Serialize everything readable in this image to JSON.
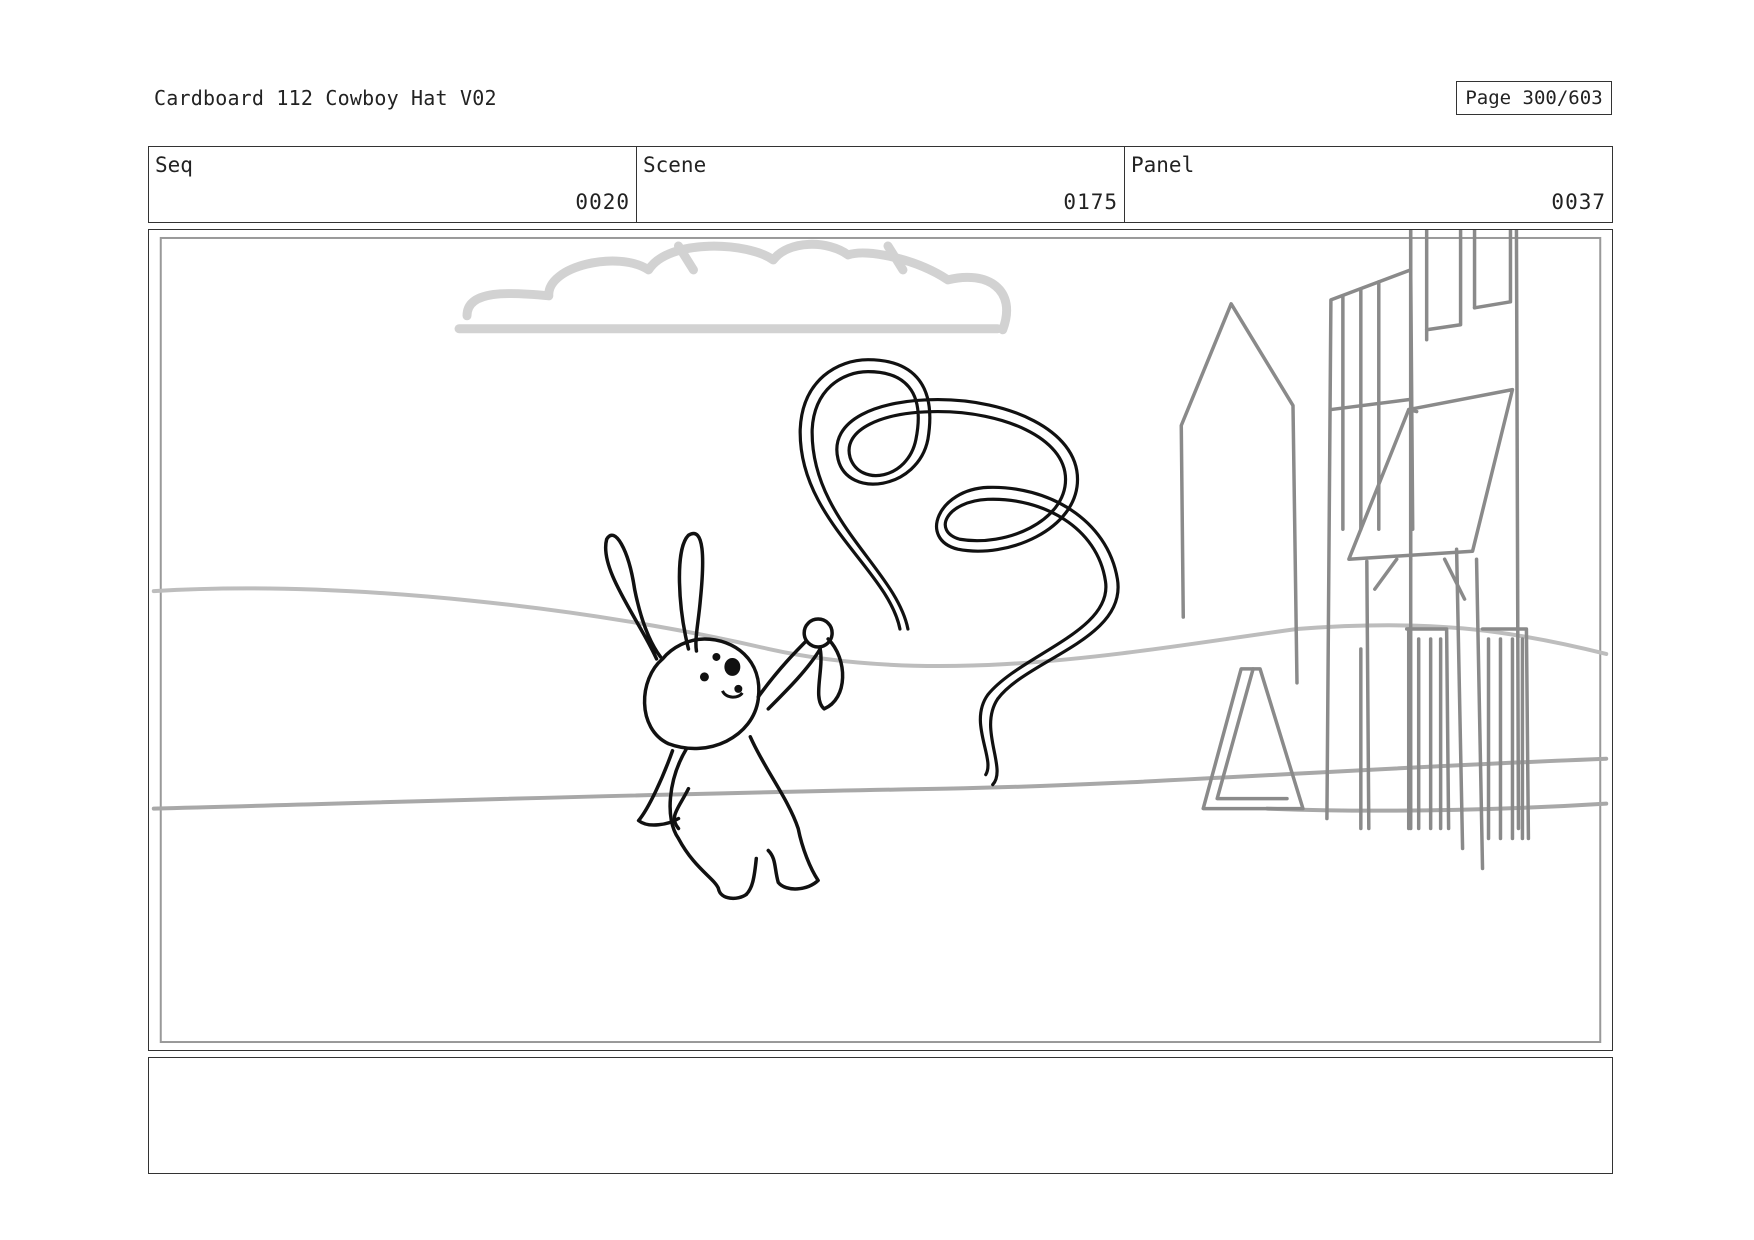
{
  "document": {
    "title": "Cardboard 112 Cowboy Hat V02",
    "page_label": "Page 300/603"
  },
  "info": {
    "seq": {
      "label": "Seq",
      "value": "0020"
    },
    "scene": {
      "label": "Scene",
      "value": "0175"
    },
    "panel": {
      "label": "Panel",
      "value": "0037"
    }
  },
  "notes": {
    "text": ""
  },
  "colors": {
    "ink": "#111111",
    "sketch_gray": "#8a8a8a",
    "light_gray": "#cccccc",
    "frame": "#333333"
  }
}
